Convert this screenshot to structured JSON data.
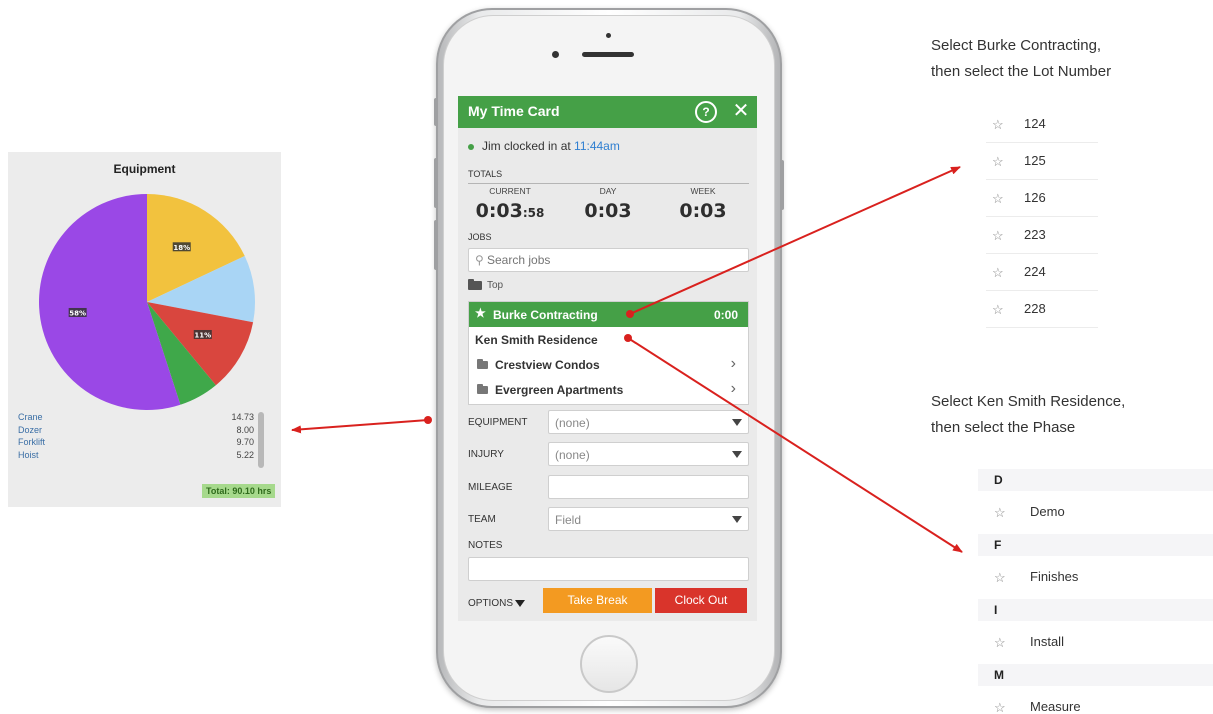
{
  "equipment": {
    "title": "Equipment",
    "items": [
      {
        "name": "Crane",
        "value": "14.73"
      },
      {
        "name": "Dozer",
        "value": "8.00"
      },
      {
        "name": "Forklift",
        "value": "9.70"
      },
      {
        "name": "Hoist",
        "value": "5.22"
      }
    ],
    "total": "Total: 90.10 hrs"
  },
  "chart_data": {
    "type": "pie",
    "title": "Equipment",
    "slices": [
      {
        "label": "",
        "percent": 18,
        "color": "#f2c23e"
      },
      {
        "label": "",
        "percent": 10,
        "color": "#a9d5f5"
      },
      {
        "label": "11%",
        "percent": 11,
        "color": "#d9463e"
      },
      {
        "label": "",
        "percent": 6,
        "color": "#3fa84a"
      },
      {
        "label": "58%",
        "percent": 55,
        "color": "#9a48e6"
      }
    ],
    "slice_labels": [
      "18%",
      "11%",
      "58%"
    ]
  },
  "app": {
    "header_title": "My Time Card",
    "help_label": "?",
    "close_label": "✕",
    "status": {
      "name": "Jim clocked in at ",
      "time": "11:44am"
    },
    "totals_label": "TOTALS",
    "totals": {
      "current_label": "CURRENT",
      "current_main": "0:03",
      "current_secs": ":58",
      "day_label": "DAY",
      "day_value": "0:03",
      "week_label": "WEEK",
      "week_value": "0:03"
    },
    "jobs_label": "JOBS",
    "search_placeholder": "Search jobs",
    "top_crumb": "Top",
    "jobs": [
      {
        "label": "Burke Contracting",
        "time": "0:00"
      },
      {
        "label": "Ken Smith Residence"
      },
      {
        "label": "Crestview Condos"
      },
      {
        "label": "Evergreen Apartments"
      }
    ],
    "fields": {
      "equipment_label": "EQUIPMENT",
      "equipment_value": "(none)",
      "injury_label": "INJURY",
      "injury_value": "(none)",
      "mileage_label": "MILEAGE",
      "mileage_value": "",
      "team_label": "TEAM",
      "team_value": "Field",
      "notes_label": "NOTES"
    },
    "options_label": "OPTIONS",
    "take_break_label": "Take Break",
    "clock_out_label": "Clock Out"
  },
  "instructions": {
    "lot": {
      "line1": "Select Burke Contracting,",
      "line2": "then select the Lot Number"
    },
    "phase": {
      "line1": "Select Ken Smith Residence,",
      "line2": "then select the Phase"
    }
  },
  "lots": [
    "124",
    "125",
    "126",
    "223",
    "224",
    "228"
  ],
  "phases": [
    {
      "group": "D",
      "name": "Demo"
    },
    {
      "group": "F",
      "name": "Finishes"
    },
    {
      "group": "I",
      "name": "Install"
    },
    {
      "group": "M",
      "name": "Measure"
    }
  ],
  "colors": {
    "header_green": "#45a047",
    "take_break": "#f39a21",
    "clock_out": "#d9342b",
    "arrow_red": "#d9211e",
    "link_blue": "#2f7fd1"
  }
}
